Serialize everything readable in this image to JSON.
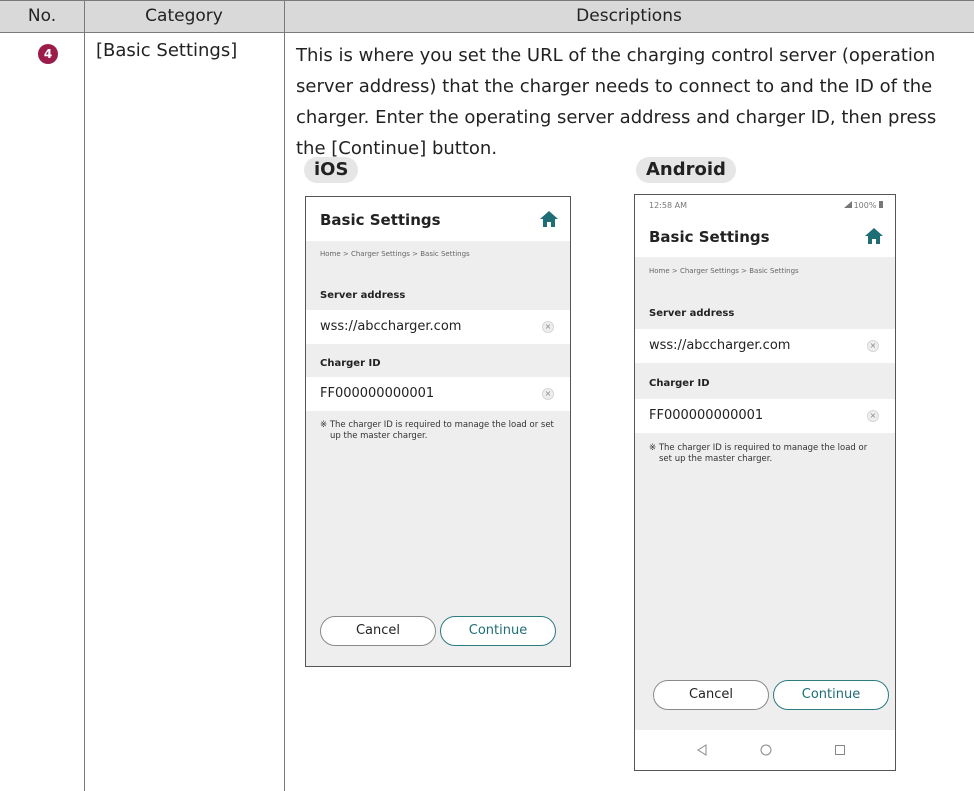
{
  "table": {
    "headers": {
      "no": "No.",
      "category": "Category",
      "descriptions": "Descriptions"
    },
    "row": {
      "no": "4",
      "category": "[Basic Settings]",
      "description": "This is where you set the URL of the charging control server (operation server address) that the charger needs to connect to and the ID of the charger. Enter the operating server address and charger ID, then press the [Continue] button."
    }
  },
  "os_labels": {
    "ios": "iOS",
    "android": "Android"
  },
  "screen": {
    "title": "Basic Settings",
    "breadcrumb": "Home > Charger Settings > Basic Settings",
    "server_label": "Server address",
    "server_value": "wss://abccharger.com",
    "charger_label": "Charger ID",
    "charger_value": "FF000000000001",
    "note": "※ The charger ID is required to manage the load or set up the master charger.",
    "cancel": "Cancel",
    "continue": "Continue",
    "clear_glyph": "×"
  },
  "android_status": {
    "time": "12:58 AM",
    "battery": "100%"
  },
  "colors": {
    "accent": "#1f6e75",
    "badge": "#9b1c4b",
    "header_bg": "#d9d9d9"
  }
}
